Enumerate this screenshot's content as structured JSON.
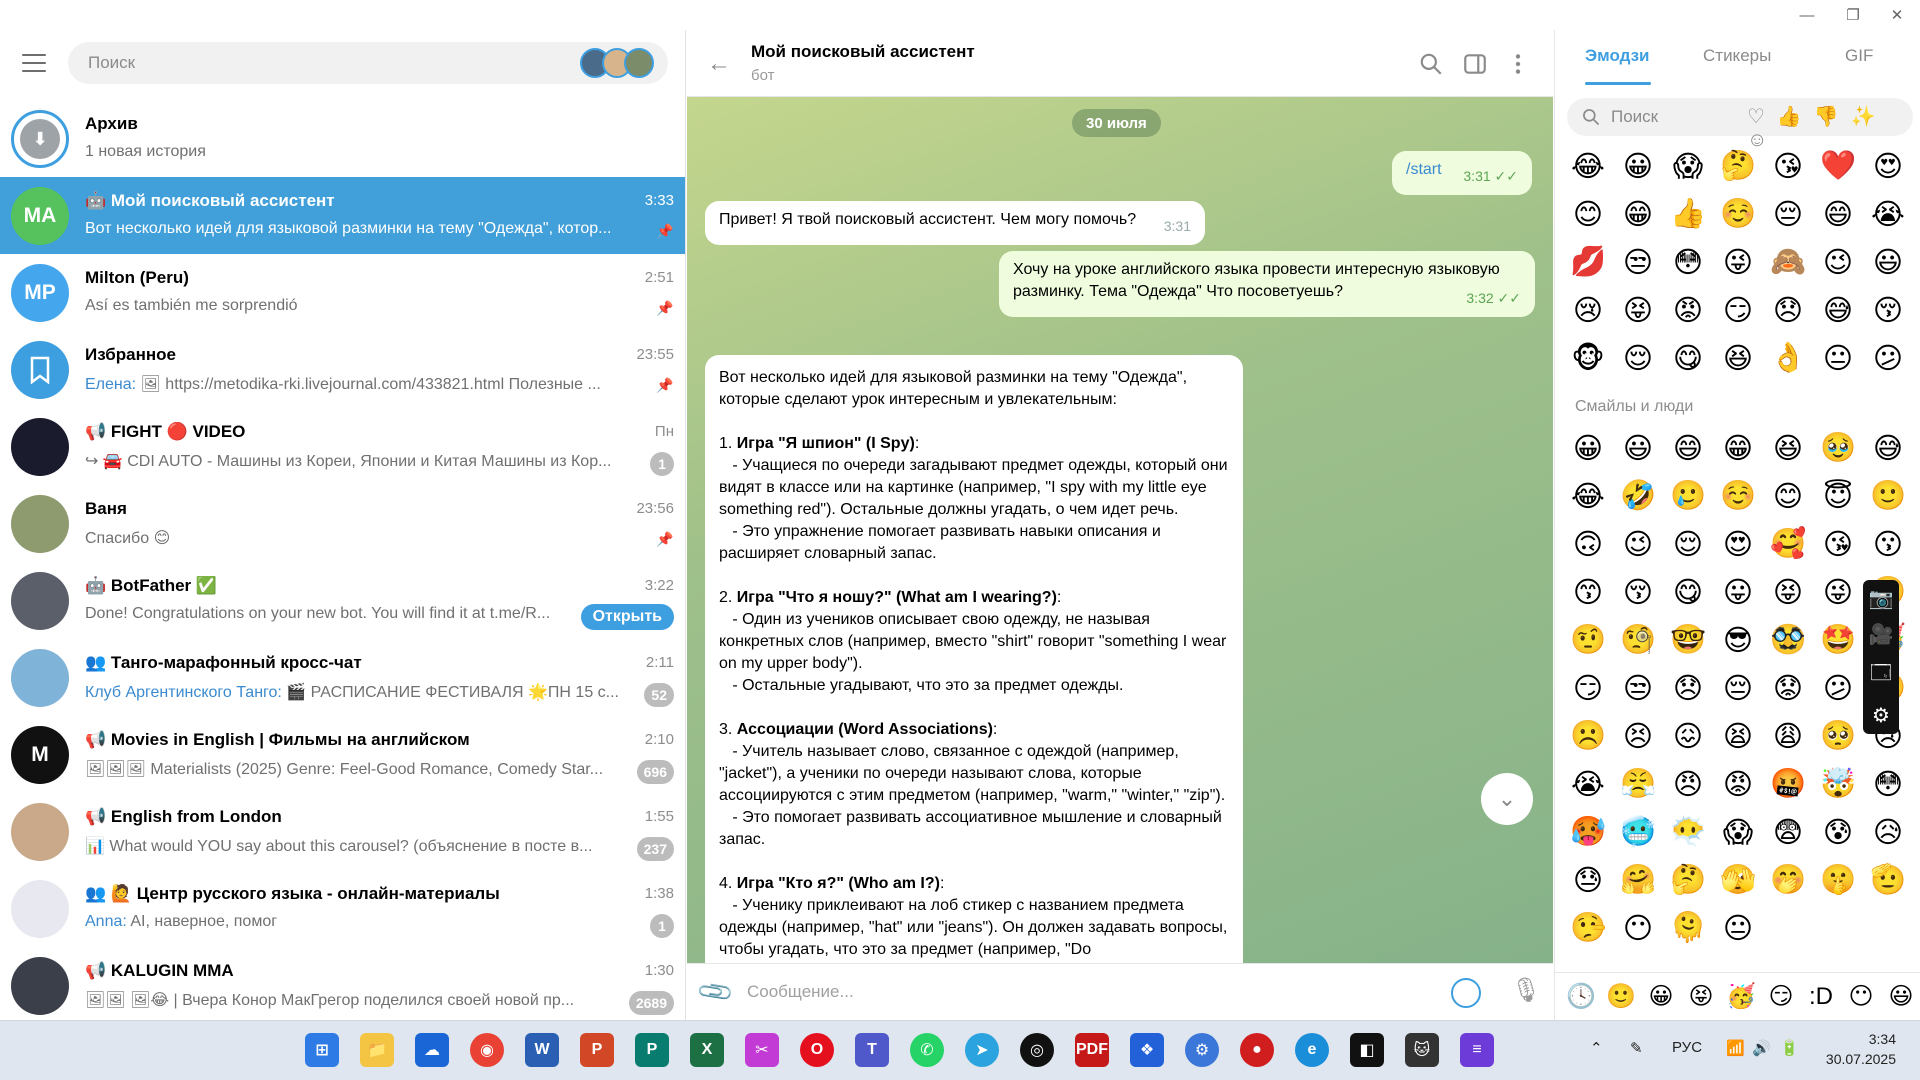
{
  "window": {
    "minimize": "—",
    "restore": "❐",
    "close": "✕"
  },
  "left": {
    "search_placeholder": "Поиск",
    "chats": [
      {
        "name": "Архив",
        "time": "",
        "preview": "1 новая история",
        "sender": "",
        "badge": "",
        "pinned": false,
        "avatar": "archive-icon",
        "avatar_color": "#9ea3a8",
        "initials": ""
      },
      {
        "name": "🤖 Мой поисковый ассистент",
        "time": "3:33",
        "preview": "Вот несколько идей для языковой разминки на тему \"Одежда\", котор...",
        "sender": "",
        "badge": "",
        "pinned": true,
        "avatar": "initials",
        "avatar_color": "#55c25e",
        "initials": "MA",
        "active": true
      },
      {
        "name": "Milton (Peru)",
        "time": "2:51",
        "preview": "Así es también me sorprendió",
        "sender": "",
        "badge": "",
        "pinned": true,
        "avatar": "initials",
        "avatar_color": "#44a6ec",
        "initials": "MP"
      },
      {
        "name": "Избранное",
        "time": "23:55",
        "preview": "🖼 https://metodika-rki.livejournal.com/433821.html  Полезные ...",
        "sender": "Елена:",
        "badge": "",
        "pinned": true,
        "avatar": "bookmark-icon",
        "avatar_color": "#3e9fe0",
        "initials": ""
      },
      {
        "name": "📢 FIGHT 🔴 VIDEO",
        "time": "Пн",
        "preview": "↪ 🚘 CDI AUTO - Машины из Кореи, Японии и Китая  Машины из Кор...",
        "sender": "",
        "badge": "1",
        "pinned": false,
        "avatar": "photo",
        "avatar_color": "#1b1b2e",
        "initials": ""
      },
      {
        "name": "Ваня",
        "time": "23:56",
        "preview": "Спасибо 😊",
        "sender": "",
        "badge": "",
        "pinned": true,
        "avatar": "photo",
        "avatar_color": "#8d9b6e",
        "initials": ""
      },
      {
        "name": "🤖 BotFather ✅",
        "time": "3:22",
        "preview": "Done! Congratulations on your new bot. You will find it at t.me/R...",
        "sender": "",
        "badge": "",
        "pinned": false,
        "avatar": "photo",
        "avatar_color": "#5a5f6a",
        "initials": "",
        "button": "Открыть"
      },
      {
        "name": "👥 Танго-марафонный кросс-чат",
        "time": "2:11",
        "preview": "🎬 РАСПИСАНИЕ ФЕСТИВАЛЯ  🌟ПН 15 с...",
        "sender": "Клуб Аргентинского Танго:",
        "badge": "52",
        "pinned": false,
        "avatar": "photo",
        "avatar_color": "#7fb3d8",
        "initials": ""
      },
      {
        "name": "📢 Movies in English | Фильмы на английском",
        "time": "2:10",
        "preview": "🖼🖼🖼 Materialists (2025)  Genre: Feel-Good Romance, Comedy Star...",
        "sender": "",
        "badge": "696",
        "pinned": false,
        "avatar": "photo",
        "avatar_color": "#111111",
        "initials": "M"
      },
      {
        "name": "📢 English from London",
        "time": "1:55",
        "preview": "What would YOU say about this carousel?  (объяснение в посте в...",
        "sender": "📊",
        "badge": "237",
        "pinned": false,
        "avatar": "photo",
        "avatar_color": "#c9a98a",
        "initials": ""
      },
      {
        "name": "👥 🙋 Центр русского языка - онлайн-материалы",
        "time": "1:38",
        "preview": "AI, наверное, помог",
        "sender": "Anna:",
        "badge": "1",
        "pinned": false,
        "avatar": "photo",
        "avatar_color": "#e8e8f0",
        "initials": ""
      },
      {
        "name": "📢 KALUGIN MMA",
        "time": "1:30",
        "preview": "🖼🖼 🖼😂 | Вчера Конор МакГрегор поделился своей новой пр...",
        "sender": "",
        "badge": "2689",
        "pinned": false,
        "avatar": "photo",
        "avatar_color": "#3b3f4a",
        "initials": ""
      }
    ]
  },
  "chat": {
    "title": "Мой поисковый ассистент",
    "subtitle": "бот",
    "date": "30 июля",
    "messages": [
      {
        "dir": "out",
        "text": "/start",
        "time": "3:31"
      },
      {
        "dir": "in",
        "text": "Привет! Я твой поисковый ассистент. Чем могу помочь?",
        "time": "3:31"
      },
      {
        "dir": "out",
        "text": "Хочу на уроке английского языка провести интересную языковую разминку. Тема \"Одежда\" Что посоветуешь?",
        "time": "3:32"
      }
    ],
    "long_message": [
      "Вот несколько идей для языковой разминки на тему \"Одежда\", которые сделают урок интересным и увлекательным:",
      "",
      "1. **Игра \"Я шпион\" (I Spy)**:",
      "   - Учащиеся по очереди загадывают предмет одежды, который они видят в классе или на картинке (например, \"I spy with my little eye something red\"). Остальные должны угадать, о чем идет речь.",
      "   - Это упражнение помогает развивать навыки описания и расширяет словарный запас.",
      "",
      "2. **Игра \"Что я ношу?\" (What am I wearing?)**:",
      "   - Один из учеников описывает свою одежду, не называя конкретных слов (например, вместо \"shirt\" говорит \"something I wear on my upper body\").",
      "   - Остальные угадывают, что это за предмет одежды.",
      "",
      "3. **Ассоциации (Word Associations)**:",
      "   - Учитель называет слово, связанное с одеждой (например, \"jacket\"), а ученики по очереди называют слова, которые ассоциируются с этим предметом (например, \"warm,\" \"winter,\" \"zip\").",
      "   - Это помогает развивать ассоциативное мышление и словарный запас.",
      "",
      "4. **Игра \"Кто я?\" (Who am I?)**:",
      "   - Ученику приклеивают на лоб стикер с названием предмета одежды (например, \"hat\" или \"jeans\"). Он должен задавать вопросы, чтобы угадать, что это за предмет (например, \"Do"
    ],
    "composer_placeholder": "Сообщение..."
  },
  "emoji_panel": {
    "tabs": [
      "Эмодзи",
      "Стикеры",
      "GIF"
    ],
    "search_placeholder": "Поиск",
    "section": "Смайлы и люди",
    "recent": [
      "😂",
      "😀",
      "😱",
      "🤔",
      "😘",
      "❤️",
      "😍",
      "😊",
      "😁",
      "👍",
      "☺️",
      "😔",
      "😄",
      "😭",
      "💋",
      "😒",
      "😳",
      "😜",
      "🙈",
      "😉",
      "😃",
      "😢",
      "😝",
      "😡",
      "😏",
      "😞",
      "😅",
      "😚",
      "🐵",
      "😌",
      "😋",
      "😆",
      "👌",
      "😐",
      "😕"
    ],
    "people": [
      "😀",
      "😃",
      "😄",
      "😁",
      "😆",
      "🥹",
      "😅",
      "😂",
      "🤣",
      "🥲",
      "☺️",
      "😊",
      "😇",
      "🙂",
      "🙃",
      "😉",
      "😌",
      "😍",
      "🥰",
      "😘",
      "😗",
      "😙",
      "😚",
      "😋",
      "😛",
      "😝",
      "😜",
      "🤪",
      "🤨",
      "🧐",
      "🤓",
      "😎",
      "🥸",
      "🤩",
      "🥳",
      "😏",
      "😒",
      "😞",
      "😔",
      "😟",
      "😕",
      "🙁",
      "☹️",
      "😣",
      "😖",
      "😫",
      "😩",
      "🥺",
      "😢",
      "😭",
      "😤",
      "😠",
      "😡",
      "🤬",
      "🤯",
      "😳",
      "🥵",
      "🥶",
      "😶‍🌫️",
      "😱",
      "😨",
      "😰",
      "😥",
      "😓",
      "🤗",
      "🤔",
      "🫣",
      "🤭",
      "🤫",
      "🫡",
      "🤥",
      "😶",
      "🫠",
      "😐"
    ],
    "bottom_icons": [
      "🕓",
      "🙂",
      "😀",
      "😝",
      "🥳",
      "😏",
      ":D",
      "😶",
      "😃"
    ]
  },
  "taskbar": {
    "lang": "РУС",
    "time": "3:34",
    "date": "30.07.2025"
  }
}
